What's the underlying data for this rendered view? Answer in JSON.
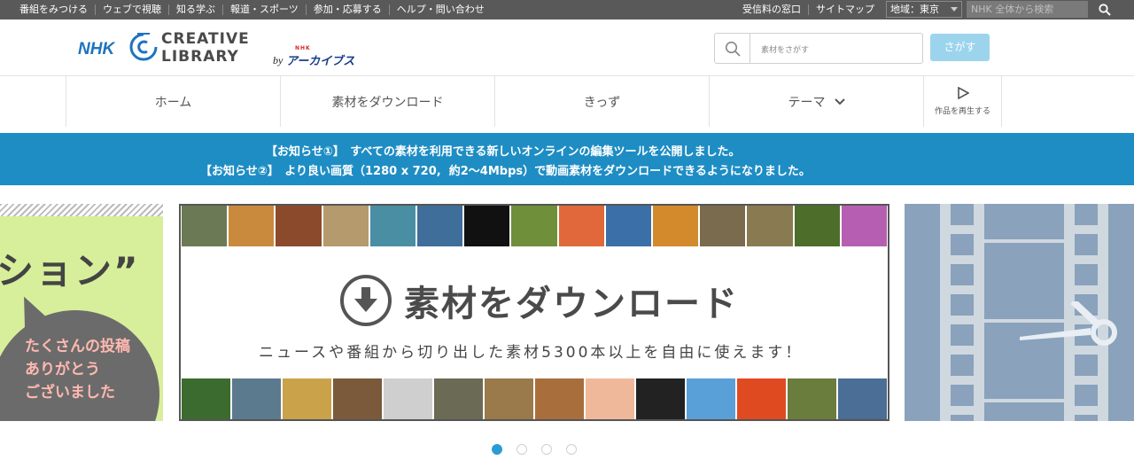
{
  "topbar": {
    "left_links": [
      "番組をみつける",
      "ウェブで視聴",
      "知る学ぶ",
      "報道・スポーツ",
      "参加・応募する",
      "ヘルプ・問い合わせ"
    ],
    "right_links": [
      "受信料の窓口",
      "サイトマップ"
    ],
    "region": "地域：東京",
    "search_placeholder": "NHK 全体から検索"
  },
  "header": {
    "logo_nhk": "NHK",
    "logo_line1": "CREATIVE",
    "logo_line2": "LIBRARY",
    "logo_by": "by",
    "logo_archives": "アーカイブス",
    "logo_archives_small": "NHK",
    "search_placeholder": "素材をさがす",
    "search_button": "さがす"
  },
  "nav": {
    "items": [
      "ホーム",
      "素材をダウンロード",
      "きっず",
      "テーマ"
    ],
    "play_label": "作品を再生する"
  },
  "announce": {
    "line1": "【お知らせ①】　すべての素材を利用できる新しいオンラインの編集ツールを公開しました。",
    "line2": "【お知らせ②】　より良い画質（1280 x 720,  約2〜4Mbps）で動画素材をダウンロードできるようになりました。"
  },
  "carousel": {
    "left": {
      "title": "ション”",
      "bubble_lines": [
        "たくさんの投稿",
        "ありがとう",
        "ございました"
      ]
    },
    "main": {
      "title": "素材をダウンロード",
      "subtitle": "ニュースや番組から切り出した素材5300本以上を自由に使えます！"
    },
    "dots": 4,
    "active_dot": 0
  },
  "colors": {
    "topbar": "#595959",
    "announce": "#1e8dc4",
    "search_button": "#9cd4ee",
    "brand_blue": "#1e73be",
    "left_slide": "#d7ef9a",
    "right_slide": "#8aa2bb"
  }
}
